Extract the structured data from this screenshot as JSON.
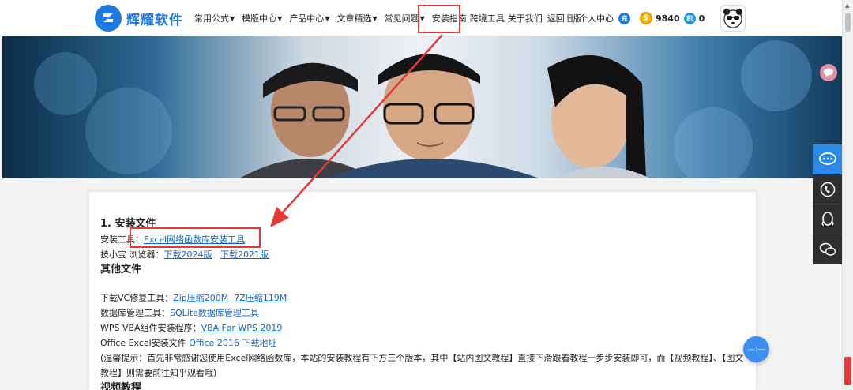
{
  "header": {
    "logo_text": "辉耀软件",
    "nav": [
      {
        "label": "常用公式",
        "dropdown": true
      },
      {
        "label": "模版中心",
        "dropdown": true
      },
      {
        "label": "产品中心",
        "dropdown": true
      },
      {
        "label": "文章精选",
        "dropdown": true
      },
      {
        "label": "常见问题",
        "dropdown": true
      },
      {
        "label": "安装指南",
        "dropdown": false
      },
      {
        "label": "跨境工具",
        "dropdown": false
      },
      {
        "label": "关于我们",
        "dropdown": false
      },
      {
        "label": "返回旧版",
        "dropdown": false
      }
    ],
    "user_center": "个人中心",
    "recharge_badge": "充",
    "coin_badge": "$",
    "coins": "9840",
    "points_badge": "积",
    "points": "0"
  },
  "content": {
    "section1_title": "1. 安装文件",
    "install_tool_label": "安装工具：",
    "install_tool_link": "Excel网络函数库安装工具",
    "browser_label": "技小宝 浏览器：",
    "browser_link_2024": "下载2024版",
    "browser_link_2021": "下载2021版",
    "other_files_title": "其他文件",
    "vc_label": "下载VC修复工具：",
    "vc_zip_link": "Zip压缩200M",
    "vc_7z_link": "7Z压缩119M",
    "db_label": "数据库管理工具：",
    "db_link": "SQLite数据库管理工具",
    "wps_label": "WPS VBA组件安装程序：",
    "wps_link": "VBA For WPS 2019",
    "office_label": "Office Excel安装文件 ",
    "office_link": "Office 2016 下载地址",
    "tip_text": "(温馨提示：首先非常感谢您使用Excel网络函数库，本站的安装教程有下方三个版本，其中【站内图文教程】直接下滑跟着教程一步步安装即可，而【视频教程】、【图文教程】则需要前往知乎观看哦)",
    "video_title": "视频教程"
  },
  "colors": {
    "brand": "#1f7ae0",
    "link": "#1565c0",
    "annotation": "#e53935",
    "sidebar_active": "#2b8ae6",
    "sidebar_dark": "#2f2f2f"
  },
  "icons": [
    "logo-icon",
    "avatar-icon",
    "chat-bubble-icon",
    "phone-icon",
    "qq-icon",
    "wechat-icon",
    "float-menu-icon"
  ]
}
